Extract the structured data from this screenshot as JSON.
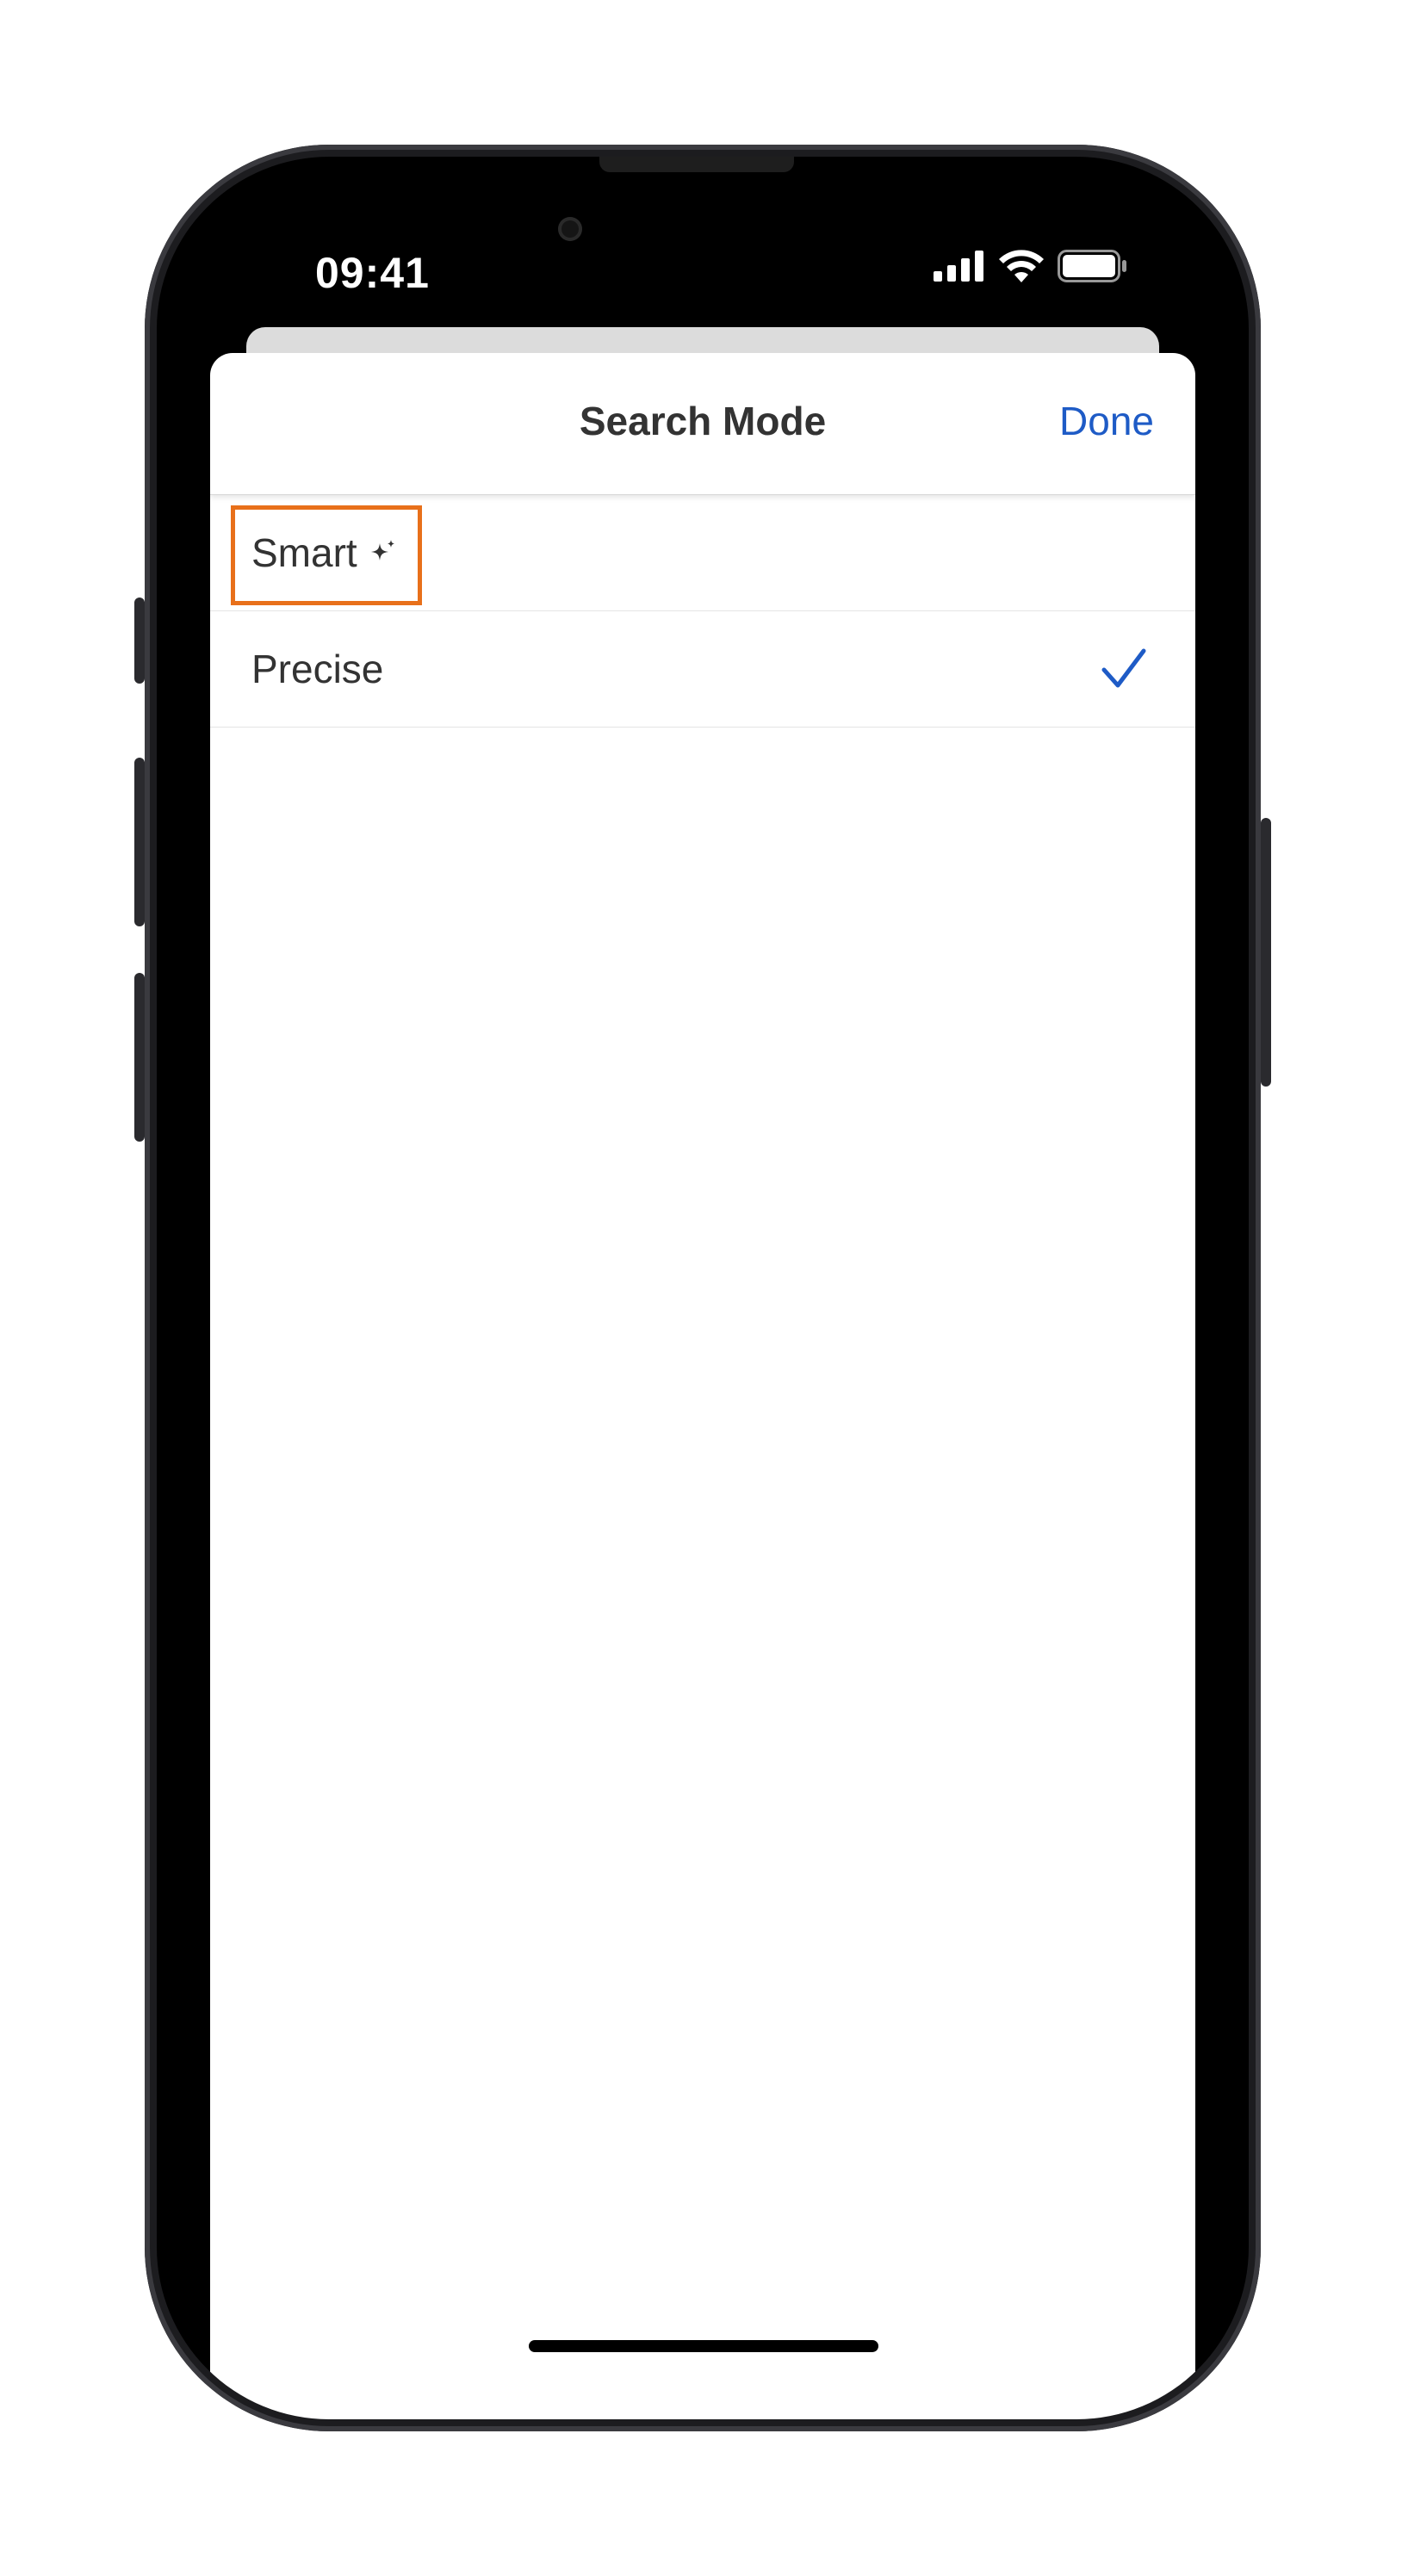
{
  "status_bar": {
    "time": "09:41",
    "icons": [
      "cellular-signal-icon",
      "wifi-icon",
      "battery-icon"
    ]
  },
  "sheet": {
    "title": "Search Mode",
    "done_label": "Done",
    "options": [
      {
        "label": "Smart",
        "icon": "sparkle-icon",
        "selected": false,
        "highlighted": true
      },
      {
        "label": "Precise",
        "selected": true
      }
    ]
  },
  "colors": {
    "accent": "#1e5bc6",
    "highlight": "#e8701a",
    "text": "#333333"
  }
}
